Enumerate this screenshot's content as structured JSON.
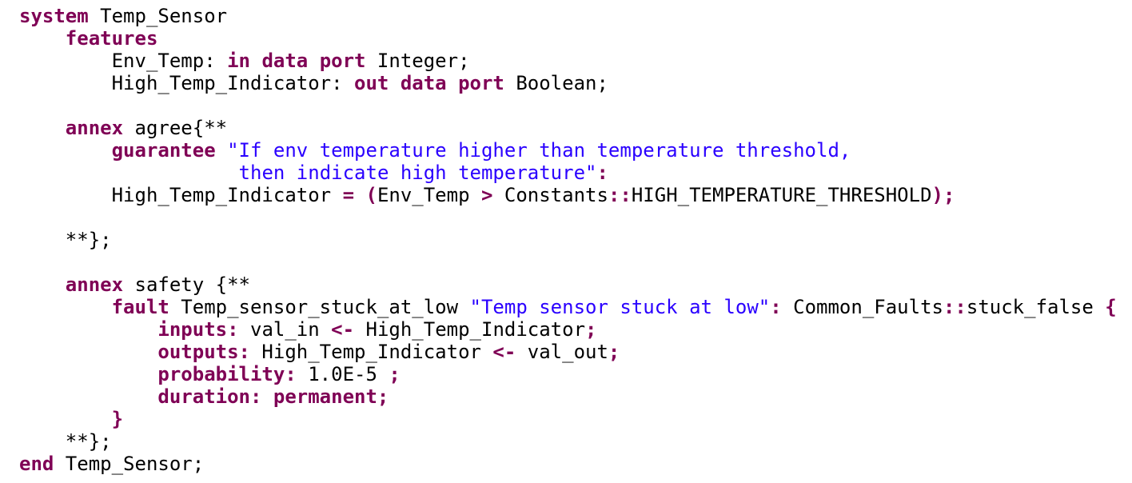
{
  "code": {
    "colors": {
      "keyword": "#7f0055",
      "string": "#2a00ff",
      "plain": "#000000"
    },
    "lines": [
      {
        "indent": 0,
        "tokens": [
          {
            "t": "system",
            "c": "kw"
          },
          {
            "t": " Temp_Sensor",
            "c": "txt"
          }
        ]
      },
      {
        "indent": 4,
        "tokens": [
          {
            "t": "features",
            "c": "kw"
          }
        ]
      },
      {
        "indent": 8,
        "tokens": [
          {
            "t": "Env_Temp: ",
            "c": "txt"
          },
          {
            "t": "in data port",
            "c": "kw"
          },
          {
            "t": " Integer;",
            "c": "txt"
          }
        ]
      },
      {
        "indent": 8,
        "tokens": [
          {
            "t": "High_Temp_Indicator: ",
            "c": "txt"
          },
          {
            "t": "out data port",
            "c": "kw"
          },
          {
            "t": " Boolean;",
            "c": "txt"
          }
        ]
      },
      {
        "indent": 0,
        "tokens": []
      },
      {
        "indent": 4,
        "tokens": [
          {
            "t": "annex",
            "c": "kw"
          },
          {
            "t": " agree{**",
            "c": "txt"
          }
        ]
      },
      {
        "indent": 8,
        "tokens": [
          {
            "t": "guarantee",
            "c": "kw"
          },
          {
            "t": " ",
            "c": "txt"
          },
          {
            "t": "\"If env temperature higher than temperature threshold,",
            "c": "str"
          }
        ]
      },
      {
        "indent": 19,
        "tokens": [
          {
            "t": "then indicate high temperature\"",
            "c": "str"
          },
          {
            "t": ":",
            "c": "kw"
          }
        ]
      },
      {
        "indent": 8,
        "tokens": [
          {
            "t": "High_Temp_Indicator ",
            "c": "txt"
          },
          {
            "t": "=",
            "c": "kw"
          },
          {
            "t": " ",
            "c": "txt"
          },
          {
            "t": "(",
            "c": "kw"
          },
          {
            "t": "Env_Temp ",
            "c": "txt"
          },
          {
            "t": ">",
            "c": "kw"
          },
          {
            "t": " Constants",
            "c": "txt"
          },
          {
            "t": "::",
            "c": "kw"
          },
          {
            "t": "HIGH_TEMPERATURE_THRESHOLD",
            "c": "txt"
          },
          {
            "t": ");",
            "c": "kw"
          }
        ]
      },
      {
        "indent": 0,
        "tokens": []
      },
      {
        "indent": 4,
        "tokens": [
          {
            "t": "**};",
            "c": "txt"
          }
        ]
      },
      {
        "indent": 0,
        "tokens": []
      },
      {
        "indent": 4,
        "tokens": [
          {
            "t": "annex",
            "c": "kw"
          },
          {
            "t": " safety {**",
            "c": "txt"
          }
        ]
      },
      {
        "indent": 8,
        "tokens": [
          {
            "t": "fault",
            "c": "kw"
          },
          {
            "t": " Temp_sensor_stuck_at_low ",
            "c": "txt"
          },
          {
            "t": "\"Temp sensor stuck at low\"",
            "c": "str"
          },
          {
            "t": ":",
            "c": "kw"
          },
          {
            "t": " Common_Faults",
            "c": "txt"
          },
          {
            "t": "::",
            "c": "kw"
          },
          {
            "t": "stuck_false ",
            "c": "txt"
          },
          {
            "t": "{",
            "c": "kw"
          }
        ]
      },
      {
        "indent": 12,
        "tokens": [
          {
            "t": "inputs:",
            "c": "kw"
          },
          {
            "t": " val_in ",
            "c": "txt"
          },
          {
            "t": "<-",
            "c": "kw"
          },
          {
            "t": " High_Temp_Indicator",
            "c": "txt"
          },
          {
            "t": ";",
            "c": "kw"
          }
        ]
      },
      {
        "indent": 12,
        "tokens": [
          {
            "t": "outputs:",
            "c": "kw"
          },
          {
            "t": " High_Temp_Indicator ",
            "c": "txt"
          },
          {
            "t": "<-",
            "c": "kw"
          },
          {
            "t": " val_out",
            "c": "txt"
          },
          {
            "t": ";",
            "c": "kw"
          }
        ]
      },
      {
        "indent": 12,
        "tokens": [
          {
            "t": "probability:",
            "c": "kw"
          },
          {
            "t": " 1.0E-5 ",
            "c": "txt"
          },
          {
            "t": ";",
            "c": "kw"
          }
        ]
      },
      {
        "indent": 12,
        "tokens": [
          {
            "t": "duration: permanent;",
            "c": "kw"
          }
        ]
      },
      {
        "indent": 8,
        "tokens": [
          {
            "t": "}",
            "c": "kw"
          }
        ]
      },
      {
        "indent": 4,
        "tokens": [
          {
            "t": "**};",
            "c": "txt"
          }
        ]
      },
      {
        "indent": 0,
        "tokens": [
          {
            "t": "end",
            "c": "kw"
          },
          {
            "t": " Temp_Sensor;",
            "c": "txt"
          }
        ]
      }
    ]
  }
}
